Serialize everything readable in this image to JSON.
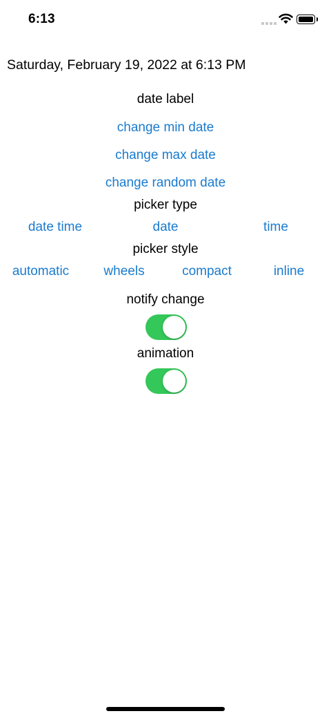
{
  "status_bar": {
    "time": "6:13"
  },
  "date_display": "Saturday, February 19, 2022 at 6:13 PM",
  "date_label": "date label",
  "actions": {
    "change_min_date": "change min date",
    "change_max_date": "change max date",
    "change_random_date": "change random date"
  },
  "picker_type": {
    "label": "picker type",
    "options": [
      "date time",
      "date",
      "time"
    ]
  },
  "picker_style": {
    "label": "picker style",
    "options": [
      "automatic",
      "wheels",
      "compact",
      "inline"
    ]
  },
  "notify_change": {
    "label": "notify change",
    "on": true
  },
  "animation": {
    "label": "animation",
    "on": true
  },
  "colors": {
    "accent": "#1a7bce",
    "toggle_on": "#34c759"
  },
  "icons": [
    "cellular-signal-icon",
    "wifi-icon",
    "battery-icon"
  ]
}
